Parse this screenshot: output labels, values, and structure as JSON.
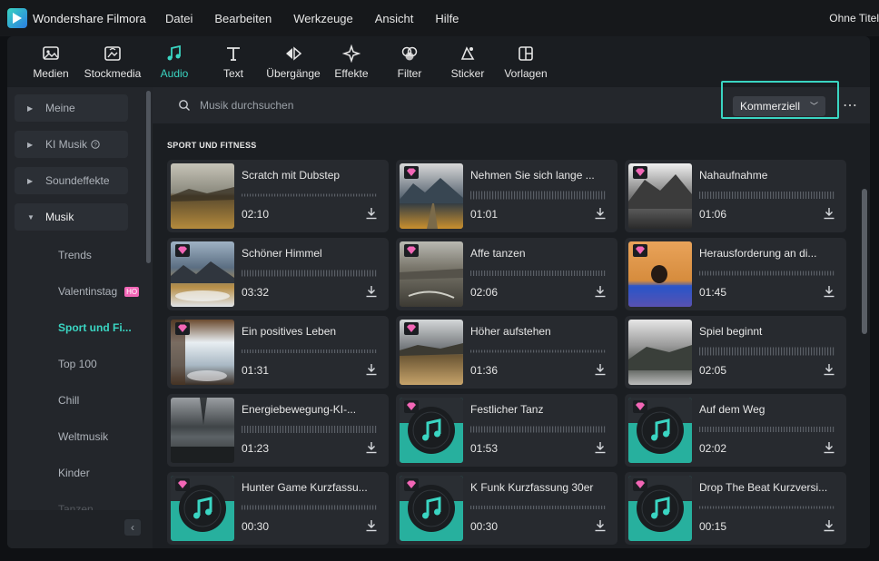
{
  "app": {
    "name": "Wondershare Filmora",
    "document_title": "Ohne Titel"
  },
  "menu": [
    "Datei",
    "Bearbeiten",
    "Werkzeuge",
    "Ansicht",
    "Hilfe"
  ],
  "toolbar": [
    {
      "label": "Medien",
      "icon": "media-icon"
    },
    {
      "label": "Stockmedia",
      "icon": "stockmedia-icon"
    },
    {
      "label": "Audio",
      "icon": "music-note-icon",
      "active": true
    },
    {
      "label": "Text",
      "icon": "text-icon"
    },
    {
      "label": "Übergänge",
      "icon": "transitions-icon"
    },
    {
      "label": "Effekte",
      "icon": "effects-icon"
    },
    {
      "label": "Filter",
      "icon": "filter-icon"
    },
    {
      "label": "Sticker",
      "icon": "sticker-icon"
    },
    {
      "label": "Vorlagen",
      "icon": "templates-icon"
    }
  ],
  "sidebar": {
    "items": [
      "Meine",
      "KI Musik",
      "Soundeffekte",
      "Musik"
    ],
    "ki_musik_icon": "help-circle-icon",
    "subitems": [
      "Trends",
      "Valentinstag",
      "Sport und Fi...",
      "Top 100",
      "Chill",
      "Weltmusik",
      "Kinder",
      "Tanzen"
    ],
    "hot_badge": "HO",
    "active_subitem": "Sport und Fi..."
  },
  "search": {
    "placeholder": "Musik durchsuchen",
    "value": ""
  },
  "filter": {
    "selected": "Kommerziell"
  },
  "section_title": "SPORT UND FITNESS",
  "accent_color": "#3ad5c2",
  "premium_color": "#f266b6",
  "tracks": [
    {
      "title": "Scratch mit Dubstep",
      "duration": "02:10",
      "premium": false,
      "thumb": "landscape-warm"
    },
    {
      "title": "Nehmen Sie sich lange ...",
      "duration": "01:01",
      "premium": true,
      "thumb": "mountain-road"
    },
    {
      "title": "Nahaufnahme",
      "duration": "01:06",
      "premium": true,
      "thumb": "bw-mountain"
    },
    {
      "title": "Schöner Himmel",
      "duration": "03:32",
      "premium": true,
      "thumb": "sky-lake"
    },
    {
      "title": "Affe tanzen",
      "duration": "02:06",
      "premium": true,
      "thumb": "plain-gray"
    },
    {
      "title": "Herausforderung an di...",
      "duration": "01:45",
      "premium": true,
      "thumb": "orange-rock"
    },
    {
      "title": "Ein positives Leben",
      "duration": "01:31",
      "premium": true,
      "thumb": "waterfall"
    },
    {
      "title": "Höher aufstehen",
      "duration": "01:36",
      "premium": true,
      "thumb": "grass-field"
    },
    {
      "title": "Spiel beginnt",
      "duration": "02:05",
      "premium": false,
      "thumb": "bw-hills"
    },
    {
      "title": "Energiebewegung-KI-...",
      "duration": "01:23",
      "premium": false,
      "thumb": "stormy-sea"
    },
    {
      "title": "Festlicher Tanz",
      "duration": "01:53",
      "premium": true,
      "thumb": "music-disc"
    },
    {
      "title": "Auf dem Weg",
      "duration": "02:02",
      "premium": true,
      "thumb": "music-disc"
    },
    {
      "title": "Hunter Game Kurzfassu...",
      "duration": "00:30",
      "premium": true,
      "thumb": "music-disc"
    },
    {
      "title": "K Funk Kurzfassung 30er",
      "duration": "00:30",
      "premium": true,
      "thumb": "music-disc"
    },
    {
      "title": "Drop The Beat Kurzversi...",
      "duration": "00:15",
      "premium": true,
      "thumb": "music-disc"
    }
  ]
}
